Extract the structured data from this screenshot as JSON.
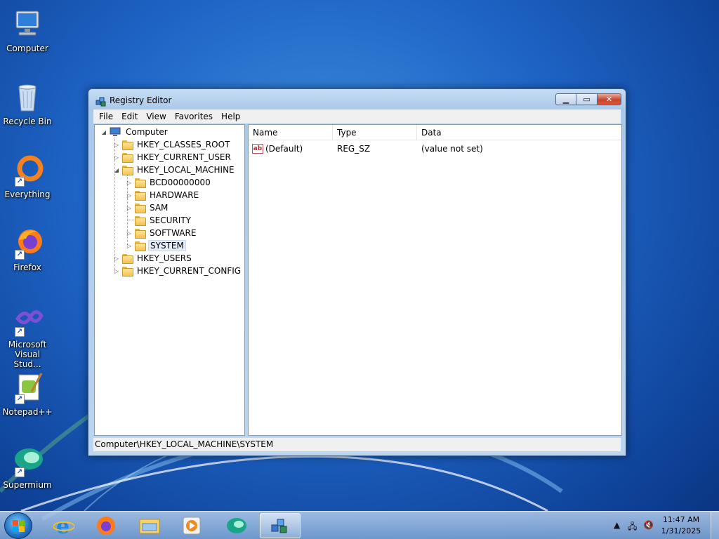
{
  "desktop": {
    "icons": [
      {
        "label": "Computer",
        "icon": "computer-icon"
      },
      {
        "label": "Recycle Bin",
        "icon": "recycle-bin-icon"
      },
      {
        "label": "Everything",
        "icon": "everything-icon"
      },
      {
        "label": "Firefox",
        "icon": "firefox-icon"
      },
      {
        "label": "Microsoft Visual Stud...",
        "icon": "visual-studio-icon"
      },
      {
        "label": "Notepad++",
        "icon": "notepadpp-icon"
      },
      {
        "label": "Supermium",
        "icon": "supermium-icon"
      }
    ]
  },
  "window": {
    "title": "Registry Editor",
    "buttons": {
      "minimize": "minimize",
      "maximize": "maximize",
      "close": "close"
    },
    "menu": [
      "File",
      "Edit",
      "View",
      "Favorites",
      "Help"
    ],
    "tree": {
      "root": "Computer",
      "hives": [
        "HKEY_CLASSES_ROOT",
        "HKEY_CURRENT_USER",
        "HKEY_LOCAL_MACHINE",
        "HKEY_USERS",
        "HKEY_CURRENT_CONFIG"
      ],
      "hklm_children": [
        "BCD00000000",
        "HARDWARE",
        "SAM",
        "SECURITY",
        "SOFTWARE",
        "SYSTEM"
      ],
      "selected": "SYSTEM"
    },
    "list": {
      "columns": [
        "Name",
        "Type",
        "Data"
      ],
      "rows": [
        {
          "name": "(Default)",
          "type": "REG_SZ",
          "data": "(value not set)"
        }
      ]
    },
    "status": "Computer\\HKEY_LOCAL_MACHINE\\SYSTEM"
  },
  "taskbar": {
    "apps": [
      "internet-explorer-icon",
      "firefox-icon",
      "file-explorer-icon",
      "media-player-icon",
      "supermium-icon",
      "registry-editor-icon"
    ],
    "active": "registry-editor-icon",
    "clock": {
      "time": "11:47 AM",
      "date": "1/31/2025"
    }
  }
}
